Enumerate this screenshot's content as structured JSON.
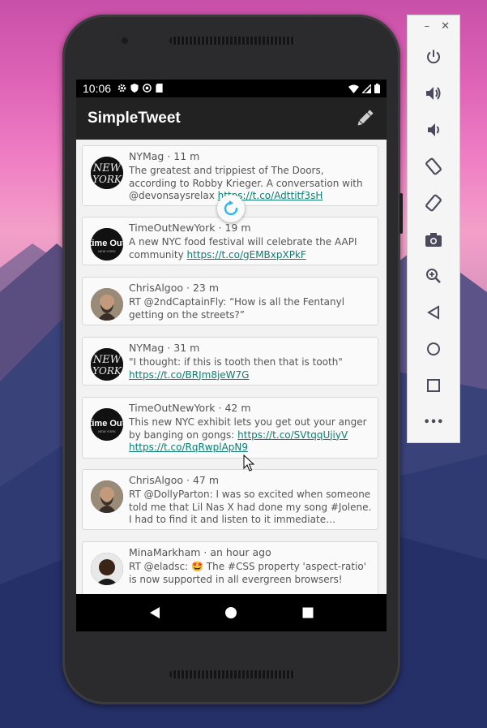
{
  "status_bar": {
    "time": "10:06"
  },
  "app": {
    "title": "SimpleTweet"
  },
  "tweets": [
    {
      "user": "NYMag",
      "time": "11 m",
      "text": "The greatest and trippiest of The Doors, according to Robby Krieger. A conversation with @devonsaysrelax ",
      "link": "https://t.co/Adttitf3sH"
    },
    {
      "user": "TimeOutNewYork",
      "time": "19 m",
      "text": "A new NYC food festival will celebrate the AAPI community ",
      "link": "https://t.co/gEMBxpXPkF"
    },
    {
      "user": "ChrisAlgoo",
      "time": "23 m",
      "text": "RT @2ndCaptainFly: “How is all the Fentanyl getting on the streets?”",
      "link": ""
    },
    {
      "user": "NYMag",
      "time": "31 m",
      "text": "\"I thought: if this is tooth then that is tooth\" ",
      "link": "https://t.co/BRJm8jeW7G"
    },
    {
      "user": "TimeOutNewYork",
      "time": "42 m",
      "text": "This new NYC exhibit lets you get out your anger by banging on gongs: ",
      "link": "https://t.co/SVtqqUjiyV",
      "link2": "https://t.co/RqRwplApN9"
    },
    {
      "user": "ChrisAlgoo",
      "time": "47 m",
      "text": "RT @DollyParton: I was so excited when someone told me that Lil Nas X had done my song #Jolene. I had to find it and listen to it immediate…",
      "link": ""
    },
    {
      "user": "MinaMarkham",
      "time": "an hour ago",
      "text": "RT @eladsc: 🤩 The #CSS property 'aspect-ratio' is now supported in all evergreen browsers!",
      "link": ""
    }
  ],
  "emulator": {
    "window": {
      "minimize": "–",
      "close": "✕"
    },
    "tools": [
      "power-icon",
      "volume-up-icon",
      "volume-down-icon",
      "rotate-left-icon",
      "rotate-right-icon",
      "camera-icon",
      "zoom-icon",
      "back-icon",
      "home-icon",
      "overview-icon",
      "more-icon"
    ],
    "more_label": "•••"
  },
  "colors": {
    "app_bar": "#222222",
    "link": "#0e7e72",
    "refresh": "#29b6f6"
  }
}
